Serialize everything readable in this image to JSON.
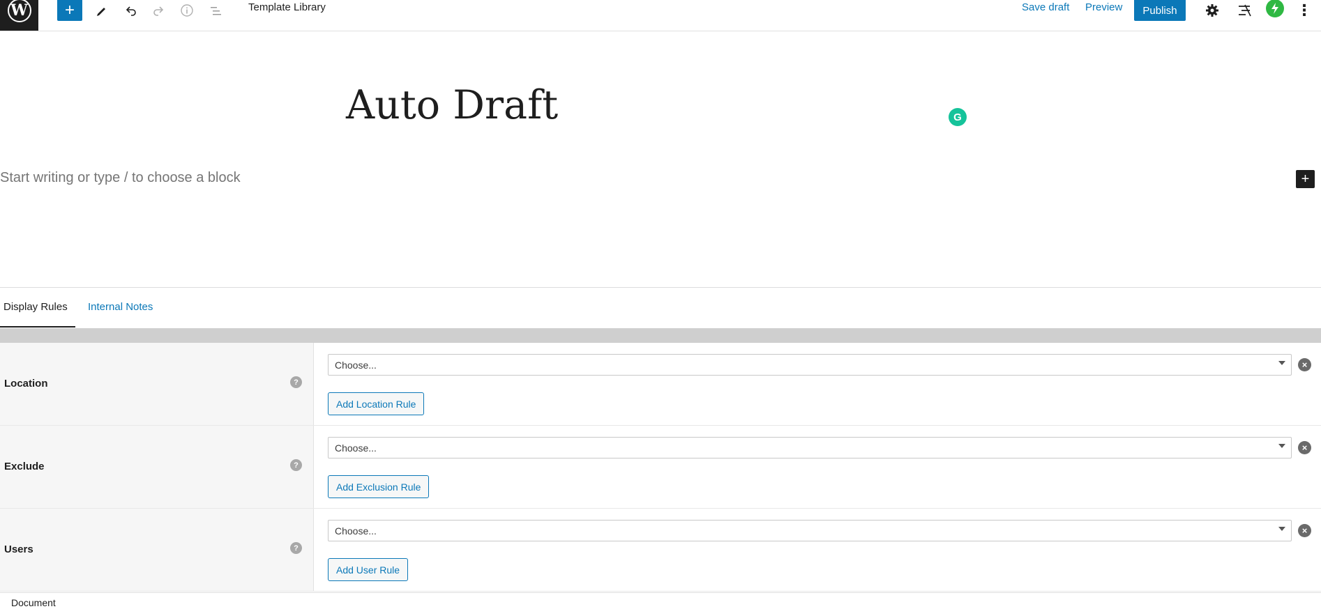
{
  "toolbar": {
    "logo": "W",
    "document_title": "Template Library",
    "save_draft": "Save draft",
    "preview": "Preview",
    "publish": "Publish",
    "icons": [
      "plus-icon",
      "pencil-icon",
      "undo-icon",
      "redo-icon",
      "info-icon",
      "list-view-icon",
      "gear-icon",
      "tools-icon",
      "bolt-icon",
      "more-vertical-icon"
    ]
  },
  "editor": {
    "post_title": "Auto Draft",
    "block_placeholder": "Start writing or type / to choose a block"
  },
  "meta_box": {
    "tabs": [
      {
        "label": "Display Rules",
        "active": true
      },
      {
        "label": "Internal Notes",
        "active": false
      }
    ],
    "rules": [
      {
        "label": "Location",
        "select_value": "Choose...",
        "add_button": "Add Location Rule"
      },
      {
        "label": "Exclude",
        "select_value": "Choose...",
        "add_button": "Add Exclusion Rule"
      },
      {
        "label": "Users",
        "select_value": "Choose...",
        "add_button": "Add User Rule"
      }
    ]
  },
  "footer": {
    "breadcrumb": "Document"
  },
  "colors": {
    "accent": "#0b78b8",
    "dark": "#1e1e1e",
    "grammarly": "#15c39a",
    "bolt": "#2fb843"
  }
}
